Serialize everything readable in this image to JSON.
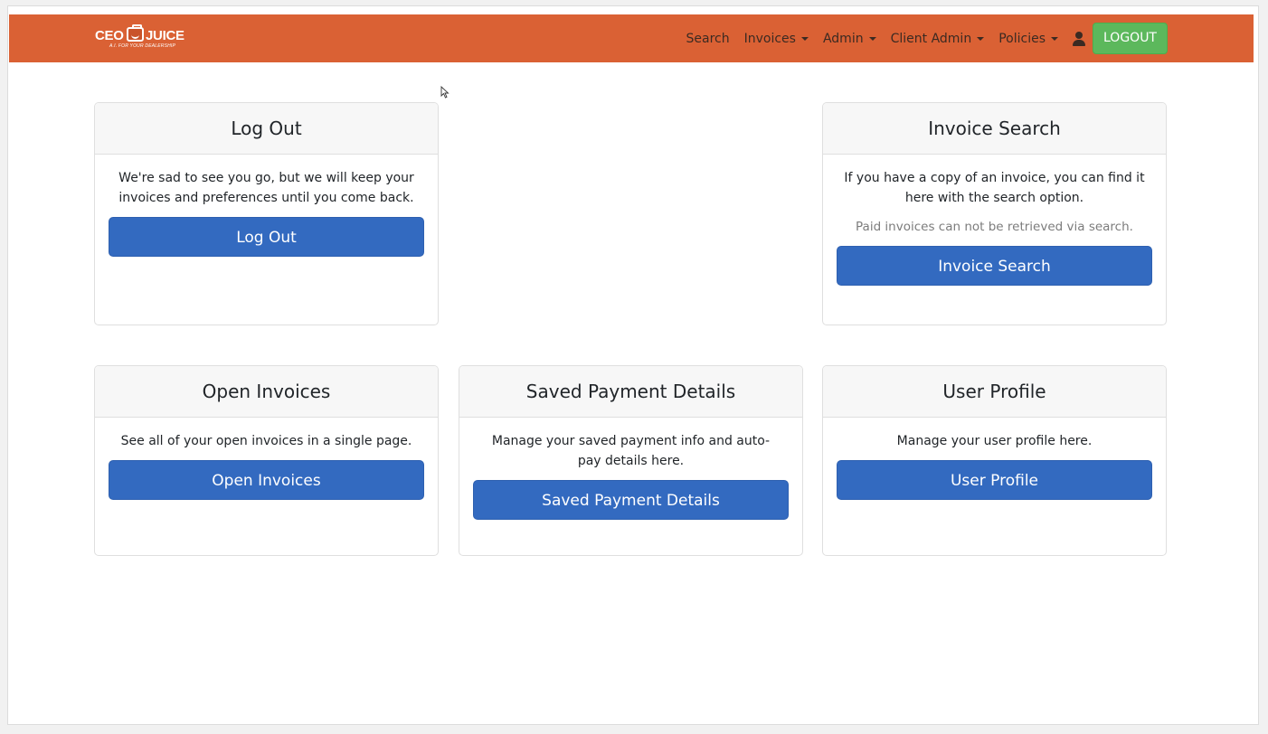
{
  "brand": {
    "name_left": "CEO",
    "name_right": "JUICE",
    "tagline": "A.I. FOR YOUR DEALERSHIP"
  },
  "nav": {
    "search": "Search",
    "invoices": "Invoices",
    "admin": "Admin",
    "client_admin": "Client Admin",
    "policies": "Policies",
    "logout": "LOGOUT"
  },
  "cards": {
    "logout": {
      "title": "Log Out",
      "text": "We're sad to see you go, but we will keep your invoices and preferences until you come back.",
      "button": "Log Out"
    },
    "invoice_search": {
      "title": "Invoice Search",
      "text": "If you have a copy of an invoice, you can find it here with the search option.",
      "note": "Paid invoices can not be retrieved via search.",
      "button": "Invoice Search"
    },
    "open_invoices": {
      "title": "Open Invoices",
      "text": "See all of your open invoices in a single page.",
      "button": "Open Invoices"
    },
    "saved_payment": {
      "title": "Saved Payment Details",
      "text": "Manage your saved payment info and auto-pay details here.",
      "button": "Saved Payment Details"
    },
    "user_profile": {
      "title": "User Profile",
      "text": "Manage your user profile here.",
      "button": "User Profile"
    }
  },
  "colors": {
    "navbar": "#da6134",
    "primary_button": "#336ac0",
    "logout_button": "#5cb85c"
  }
}
